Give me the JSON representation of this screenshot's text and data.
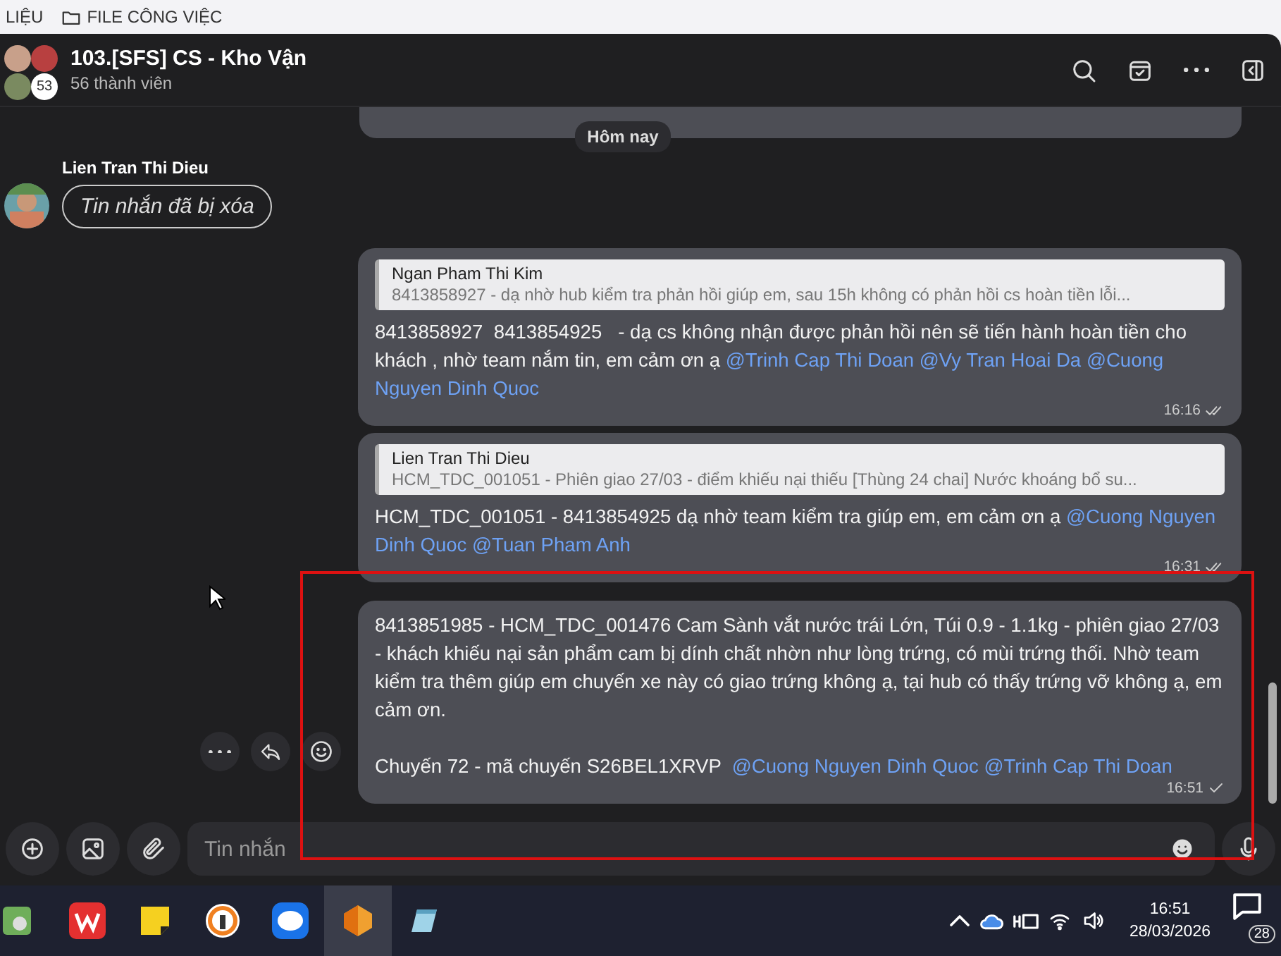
{
  "topbar": {
    "items": [
      {
        "label": "LIỆU",
        "kind": "text"
      },
      {
        "label": "FILE CÔNG VIỆC",
        "kind": "folder"
      }
    ]
  },
  "chat": {
    "title": "103.[SFS] CS - Kho Vận",
    "members": "56 thành viên",
    "avatar_count": "53"
  },
  "date_label": "Hôm nay",
  "messages": [
    {
      "kind": "deleted",
      "sender": "Lien Tran Thi Dieu",
      "text": "Tin nhắn đã bị xóa"
    },
    {
      "kind": "own",
      "quote": {
        "author": "Ngan Pham Thi Kim",
        "text": "8413858927 - dạ nhờ hub kiểm tra phản hồi giúp em, sau 15h không có phản hồi cs hoàn tiền lỗi..."
      },
      "parts": [
        {
          "text": "8413858927  8413854925   - dạ cs không nhận được phản hồi nên sẽ tiến hành hoàn tiền cho khách , nhờ team nắm tin, em cảm ơn ạ ",
          "mention": false
        },
        {
          "text": "@Trinh Cap Thi Doan @Vy Tran Hoai Da @Cuong Nguyen Dinh Quoc",
          "mention": true
        }
      ],
      "time": "16:16",
      "read": true,
      "actions": false
    },
    {
      "kind": "own",
      "quote": {
        "author": "Lien Tran Thi Dieu",
        "text": "HCM_TDC_001051 - Phiên giao 27/03 - điểm khiếu nại thiếu [Thùng 24 chai] Nước khoáng bổ su..."
      },
      "parts": [
        {
          "text": "HCM_TDC_001051 - 8413854925 dạ nhờ team kiểm tra giúp em, em cảm ơn ạ ",
          "mention": false
        },
        {
          "text": "@Cuong Nguyen Dinh Quoc @Tuan Pham Anh",
          "mention": true
        }
      ],
      "time": "16:31",
      "read": true,
      "actions": false
    },
    {
      "kind": "own",
      "parts": [
        {
          "text": "8413851985 - HCM_TDC_001476 Cam Sành vắt nước trái Lớn, Túi 0.9 - 1.1kg - phiên giao 27/03 - khách khiếu nại sản phẩm cam bị dính chất nhờn như lòng trứng, có mùi trứng thối. Nhờ team kiểm tra thêm giúp em chuyến xe này có giao trứng không ạ, tại hub có thấy trứng vỡ không ạ, em cảm ơn.\n\nChuyến 72 - mã chuyến S26BEL1XRVP  ",
          "mention": false
        },
        {
          "text": "@Cuong Nguyen Dinh Quoc @Trinh Cap Thi Doan",
          "mention": true
        }
      ],
      "time": "16:51",
      "read": false,
      "actions": true,
      "highlighted": true
    }
  ],
  "composer": {
    "placeholder": "Tin nhắn"
  },
  "taskbar": {
    "time": "16:51",
    "date": "28/03/2026",
    "notifications": "28"
  }
}
